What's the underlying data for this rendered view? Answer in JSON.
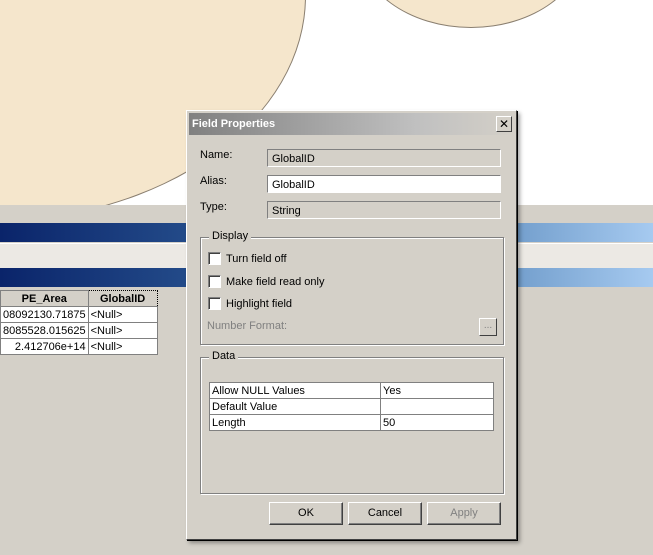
{
  "dialog": {
    "title": "Field Properties",
    "close_glyph": "✕",
    "name_label": "Name:",
    "name_value": "GlobalID",
    "alias_label": "Alias:",
    "alias_value": "GlobalID",
    "type_label": "Type:",
    "type_value": "String",
    "display": {
      "title": "Display",
      "options": [
        {
          "label": "Turn field off",
          "checked": false
        },
        {
          "label": "Make field read only",
          "checked": false
        },
        {
          "label": "Highlight field",
          "checked": false
        }
      ],
      "number_format_label": "Number Format:",
      "ellipsis_label": "..."
    },
    "data": {
      "title": "Data",
      "rows": [
        {
          "key": "Allow NULL Values",
          "value": "Yes"
        },
        {
          "key": "Default Value",
          "value": ""
        },
        {
          "key": "Length",
          "value": "50"
        }
      ]
    },
    "buttons": {
      "ok": "OK",
      "cancel": "Cancel",
      "apply": "Apply"
    }
  },
  "attribute_table": {
    "columns": [
      "PE_Area",
      "GlobalID"
    ],
    "rows": [
      [
        "08092130.71875",
        "<Null>"
      ],
      [
        "8085528.015625",
        "<Null>"
      ],
      [
        "2.412706e+14",
        "<Null>"
      ]
    ]
  }
}
